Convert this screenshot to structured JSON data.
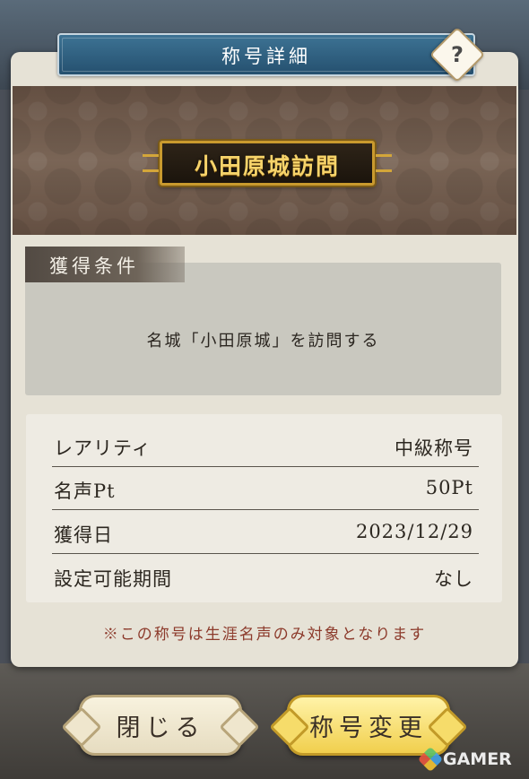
{
  "dialog": {
    "title": "称号詳細",
    "help_glyph": "?"
  },
  "title_plate": {
    "text": "小田原城訪問"
  },
  "condition": {
    "heading": "獲得条件",
    "text": "名城「小田原城」を訪問する"
  },
  "details": [
    {
      "label": "レアリティ",
      "value": "中級称号"
    },
    {
      "label": "名声Pt",
      "value": "50Pt"
    },
    {
      "label": "獲得日",
      "value": "2023/12/29"
    },
    {
      "label": "設定可能期間",
      "value": "なし"
    }
  ],
  "note": "※この称号は生涯名声のみ対象となります",
  "buttons": {
    "close": "閉じる",
    "change": "称号変更"
  },
  "watermark": "GAMER",
  "colors": {
    "title_bar": "#2f6485",
    "note_text": "#8c3a2b",
    "change_button": "#f1cf4d",
    "close_button": "#efe6cd",
    "plate_gold": "#f6d36a"
  }
}
